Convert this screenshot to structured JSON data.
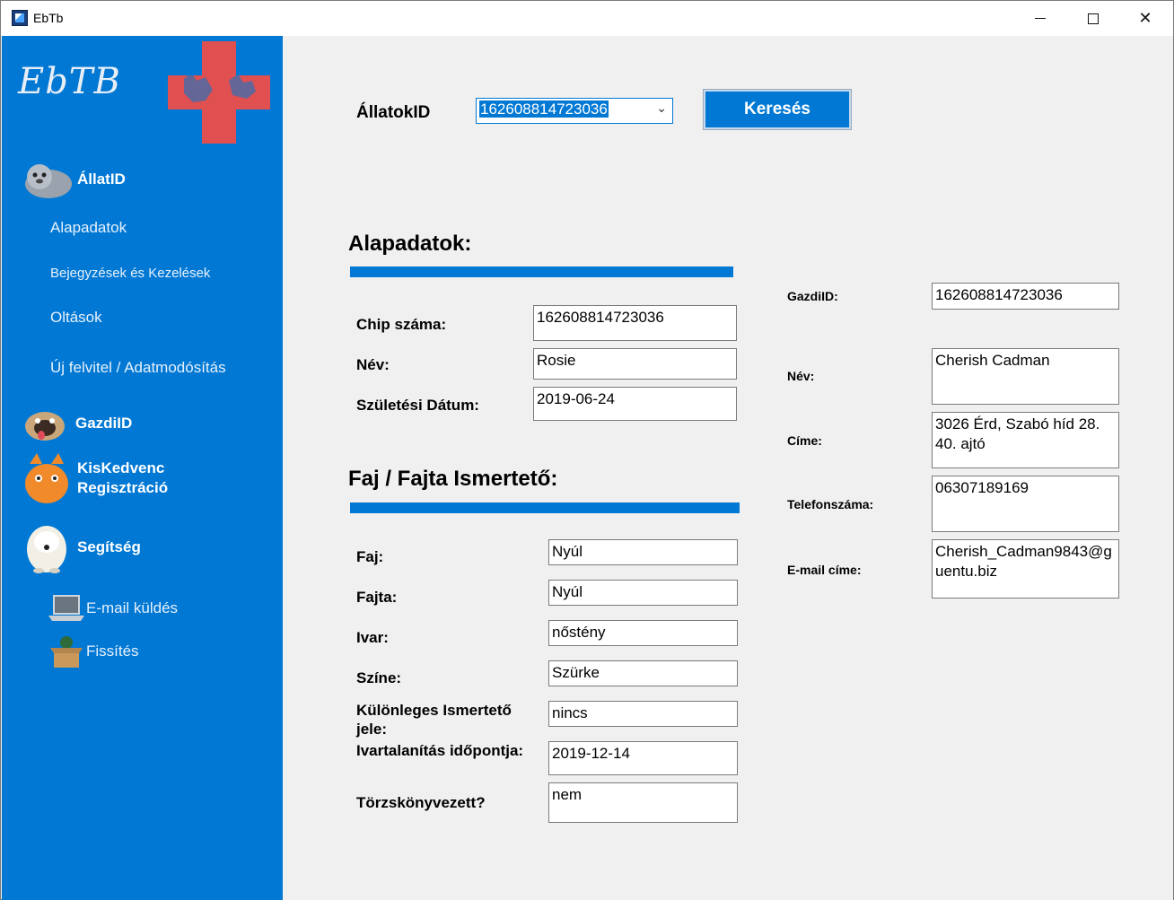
{
  "window": {
    "title": "EbTb",
    "minimize_glyph": "—",
    "maximize_glyph": "☐",
    "close_glyph": "✕"
  },
  "sidebar": {
    "logo_text": "EbTB",
    "sections": {
      "allat": {
        "label": "ÁllatID",
        "icon": "seal-animal-icon"
      },
      "gazdi": {
        "label": "GazdiID",
        "icon": "pug-dog-icon"
      },
      "kiskedvenc": {
        "label_line1": "KisKedvenc",
        "label_line2": "Regisztráció",
        "icon": "orange-cat-icon"
      },
      "segitseg": {
        "label": "Segítség",
        "icon": "sheepdog-icon"
      }
    },
    "sub_items": [
      "Alapadatok",
      "Bejegyzések és Kezelések",
      "Oltások",
      "Új felvitel / Adatmodósítás"
    ],
    "tools": [
      {
        "label": "E-mail küldés",
        "icon": "laptop-icon"
      },
      {
        "label": "Fissítés",
        "icon": "box-cat-icon"
      }
    ]
  },
  "search": {
    "label": "ÁllatokID",
    "selected_value": "162608814723036",
    "button_label": "Keresés"
  },
  "alapadatok": {
    "heading": "Alapadatok:",
    "chip_label": "Chip száma:",
    "chip_value": "162608814723036",
    "nev_label": "Név:",
    "nev_value": "Rosie",
    "szul_label": "Születési Dátum:",
    "szul_value": "2019-06-24"
  },
  "fajta": {
    "heading": "Faj / Fajta Ismertető:",
    "faj_label": "Faj:",
    "faj_value": "Nyúl",
    "fajta_label": "Fajta:",
    "fajta_value": "Nyúl",
    "ivar_label": "Ivar:",
    "ivar_value": "nőstény",
    "szine_label": "Színe:",
    "szine_value": "Szürke",
    "kulonleges_label": "Különleges Ismertető jele:",
    "kulonleges_value": "nincs",
    "ivartalanitas_label": "Ivartalanítás időpontja:",
    "ivartalanitas_value": "2019-12-14",
    "torzs_label": "Törzskönyvezett?",
    "torzs_value": "nem"
  },
  "gazdi": {
    "id_label": "GazdiID:",
    "id_value": "162608814723036",
    "nev_label": "Név:",
    "nev_value": "Cherish Cadman",
    "cime_label": "Címe:",
    "cime_value": "3026 Érd, Szabó híd 28. 40. ajtó",
    "tel_label": "Telefonszáma:",
    "tel_value": "06307189169",
    "email_label": "E-mail címe:",
    "email_value": "Cherish_Cadman9843@guentu.biz"
  },
  "colors": {
    "accent": "#0078d4",
    "logo_cross": "#e05050",
    "background": "#f0f0f0"
  }
}
